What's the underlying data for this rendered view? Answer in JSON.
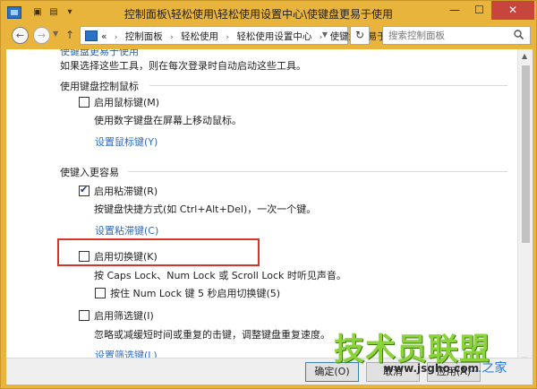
{
  "window": {
    "title": "控制面板\\轻松使用\\轻松使用设置中心\\使键盘更易于使用",
    "min_glyph": "—",
    "max_glyph": "☐",
    "close_glyph": "✕"
  },
  "navbar": {
    "overflow_glyph": "«",
    "crumbs": [
      "控制面板",
      "轻松使用",
      "轻松使用设置中心",
      "使键盘更易于使用"
    ],
    "search_placeholder": "搜索控制面板"
  },
  "content": {
    "cut_title": "使键盘更易于使用",
    "intro": "如果选择这些工具，则在每次登录时自动启动这些工具。",
    "mouse_section": {
      "heading": "使用键盘控制鼠标",
      "mouse_keys_label": "启用鼠标键(M)",
      "mouse_keys_checked": false,
      "mouse_keys_desc": "使用数字键盘在屏幕上移动鼠标。",
      "setup_link": "设置鼠标键(Y)"
    },
    "typing_section": {
      "heading": "使键入更容易",
      "sticky_label": "启用粘滞键(R)",
      "sticky_checked": true,
      "sticky_desc": "按键盘快捷方式(如 Ctrl+Alt+Del)，一次一个键。",
      "sticky_link": "设置粘滞键(C)",
      "toggle_label": "启用切换键(K)",
      "toggle_checked": false,
      "toggle_desc": "按 Caps Lock、Num Lock 或 Scroll Lock 时听见声音。",
      "numlock_label": "按住 Num Lock 键 5 秒启用切换键(5)",
      "numlock_checked": false,
      "filter_label": "启用筛选键(I)",
      "filter_checked": false,
      "filter_desc": "忽略或减缓短时间或重复的击键，调整键盘重复速度。",
      "filter_link": "设置筛选键(L)"
    }
  },
  "buttons": {
    "ok": "确定(O)",
    "cancel": "取消",
    "apply": "应用(A)"
  },
  "watermark": {
    "main": "技术员联盟",
    "sub": "www.jsgho.com",
    "tag": "...之家"
  },
  "colors": {
    "title_bar": "#e9b43c",
    "close_button": "#c7453c",
    "link": "#2d6bc4",
    "highlight": "#d9342b",
    "watermark": "#8ad43a"
  }
}
